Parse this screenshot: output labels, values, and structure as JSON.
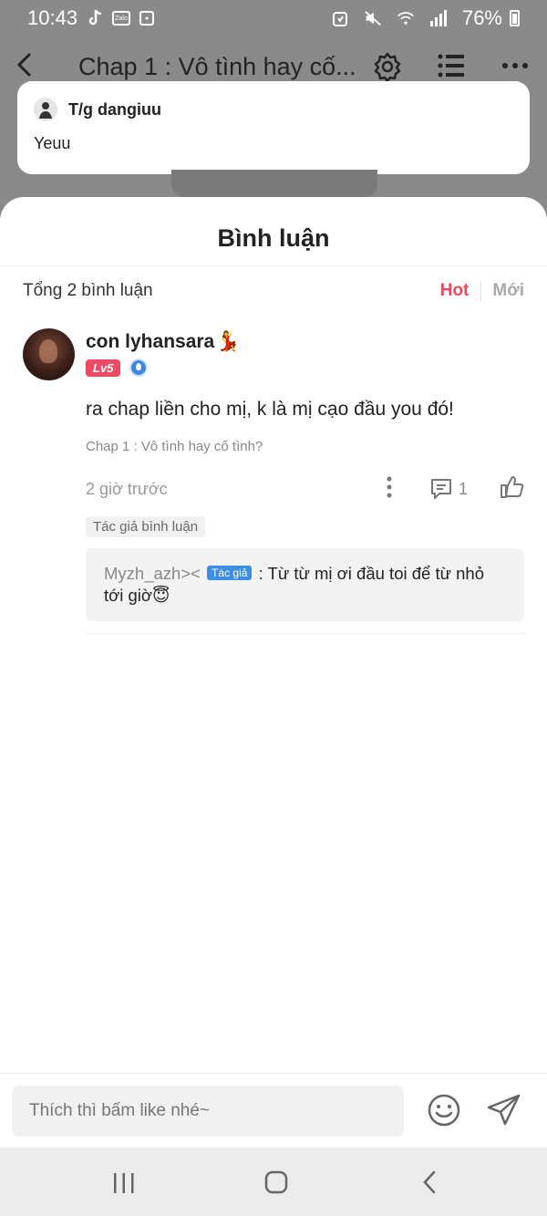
{
  "status_bar": {
    "time": "10:43",
    "battery": "76%",
    "icons": [
      "tiktok-icon",
      "zalo-icon",
      "app-icon",
      "alarm-icon",
      "mute-icon",
      "wifi-icon",
      "signal-icon",
      "battery-icon"
    ]
  },
  "top_bar": {
    "title": "Chap 1 : Vô tình hay cố..."
  },
  "toast": {
    "author": "T/g dangiuu",
    "message": "Yeuu"
  },
  "sheet": {
    "title": "Bình luận",
    "total": "Tổng 2 bình luận",
    "sort_hot": "Hot",
    "sort_new": "Mới"
  },
  "comment": {
    "username": "con lyhansara",
    "emoji": "💃",
    "level": "Lv5",
    "text": "ra chap liền cho mị, k là mị cạo đầu you đó!",
    "chapter": "Chap 1 : Vô tình hay cố tình?",
    "time": "2 giờ trước",
    "reply_count": "1",
    "tag": "Tác giả bình luận",
    "reply": {
      "user": "Myzh_azh><",
      "badge": "Tác giả",
      "text": ": Từ từ mị ơi đầu toi để từ nhỏ tới giờ😇"
    }
  },
  "input": {
    "placeholder": "Thích thì bấm like nhé~"
  },
  "colors": {
    "accent": "#e8495e",
    "author_badge": "#3d8fe6",
    "level_badge": "#ee4a64"
  }
}
